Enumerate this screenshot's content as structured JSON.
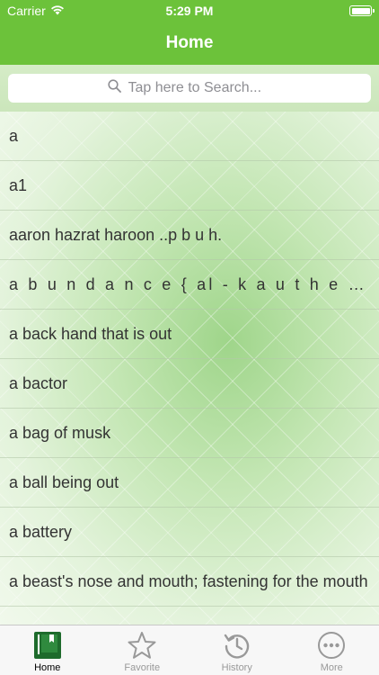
{
  "status_bar": {
    "carrier": "Carrier",
    "time": "5:29 PM"
  },
  "nav": {
    "title": "Home"
  },
  "search": {
    "placeholder": "Tap here to Search..."
  },
  "list": {
    "items": [
      "a",
      "a1",
      "aaron hazrat haroon ..p b u h.",
      "a b u n d a n c e { al - k a u t h e r }",
      "a back hand that is out",
      "a bactor",
      "a bag of musk",
      "a ball being out",
      "a battery",
      "a beast's nose and mouth; fastening for the mouth"
    ]
  },
  "tabs": [
    {
      "label": "Home",
      "icon": "book-icon",
      "active": true
    },
    {
      "label": "Favorite",
      "icon": "star-icon",
      "active": false
    },
    {
      "label": "History",
      "icon": "history-icon",
      "active": false
    },
    {
      "label": "More",
      "icon": "more-icon",
      "active": false
    }
  ],
  "colors": {
    "accent": "#6cc23a",
    "active_tab": "#1e6b2c",
    "inactive_tab": "#999999"
  }
}
